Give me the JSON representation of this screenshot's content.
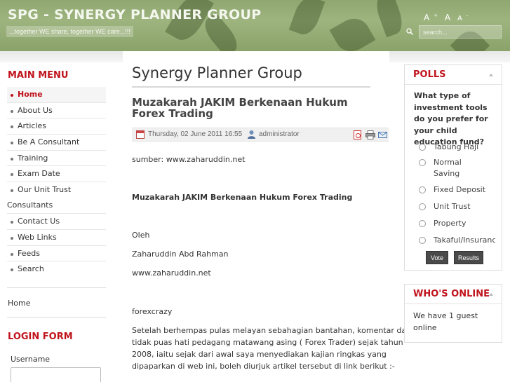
{
  "header": {
    "site_title": "SPG - SYNERGY PLANNER GROUP",
    "tagline": "...together WE share, together WE care...!!!",
    "font_tools": {
      "larger": "A",
      "larger_sup": "+",
      "reset": "A",
      "smaller": "A",
      "smaller_sup": "-"
    },
    "search_placeholder": "search..."
  },
  "left": {
    "main_menu_title": "MAIN MENU",
    "menu": [
      "Home",
      "About Us",
      "Articles",
      "Be A Consultant",
      "Training",
      "Exam Date",
      "Our Unit Trust",
      "Contact Us",
      "Web Links",
      "Feeds",
      "Search"
    ],
    "menu_wrap_second": "Consultants",
    "home_link": "Home",
    "login_title": "LOGIN FORM",
    "username_label": "Username"
  },
  "main": {
    "page_title": "Synergy Planner Group",
    "article_title": "Muzakarah JAKIM Berkenaan Hukum Forex Trading",
    "date": "Thursday, 02 June 2011 16:55",
    "author": "administrator",
    "body": [
      "sumber: www.zaharuddin.net",
      "Muzakarah JAKIM Berkenaan Hukum Forex Trading",
      "Oleh",
      "Zaharuddin Abd Rahman",
      "www.zaharuddin.net",
      "forexcrazy",
      "Setelah berhempas pulas melayan sebahagian bantahan, komentar dan",
      "tidak puas hati pedagang matawang asing ( Forex Trader) sejak tahun",
      "2008, iaitu sejak dari awal saya menyediakan kajian ringkas yang",
      "dipaparkan di web ini, boleh diurjuk artikel tersebut di link berikut :-"
    ]
  },
  "right": {
    "polls_title": "POLLS",
    "poll_question": "What type of investment tools do you prefer for your child education fund?",
    "poll_options": [
      "Tabung Haji",
      "Normal Saving Account",
      "Fixed Deposit",
      "Unit Trust",
      "Property",
      "Takaful/Insurance"
    ],
    "vote_label": "Vote",
    "results_label": "Results",
    "online_title": "WHO'S ONLINE",
    "online_text": "We have 1 guest online"
  },
  "colors": {
    "accent": "#c0131c",
    "header_bg": "#9eb47f"
  }
}
